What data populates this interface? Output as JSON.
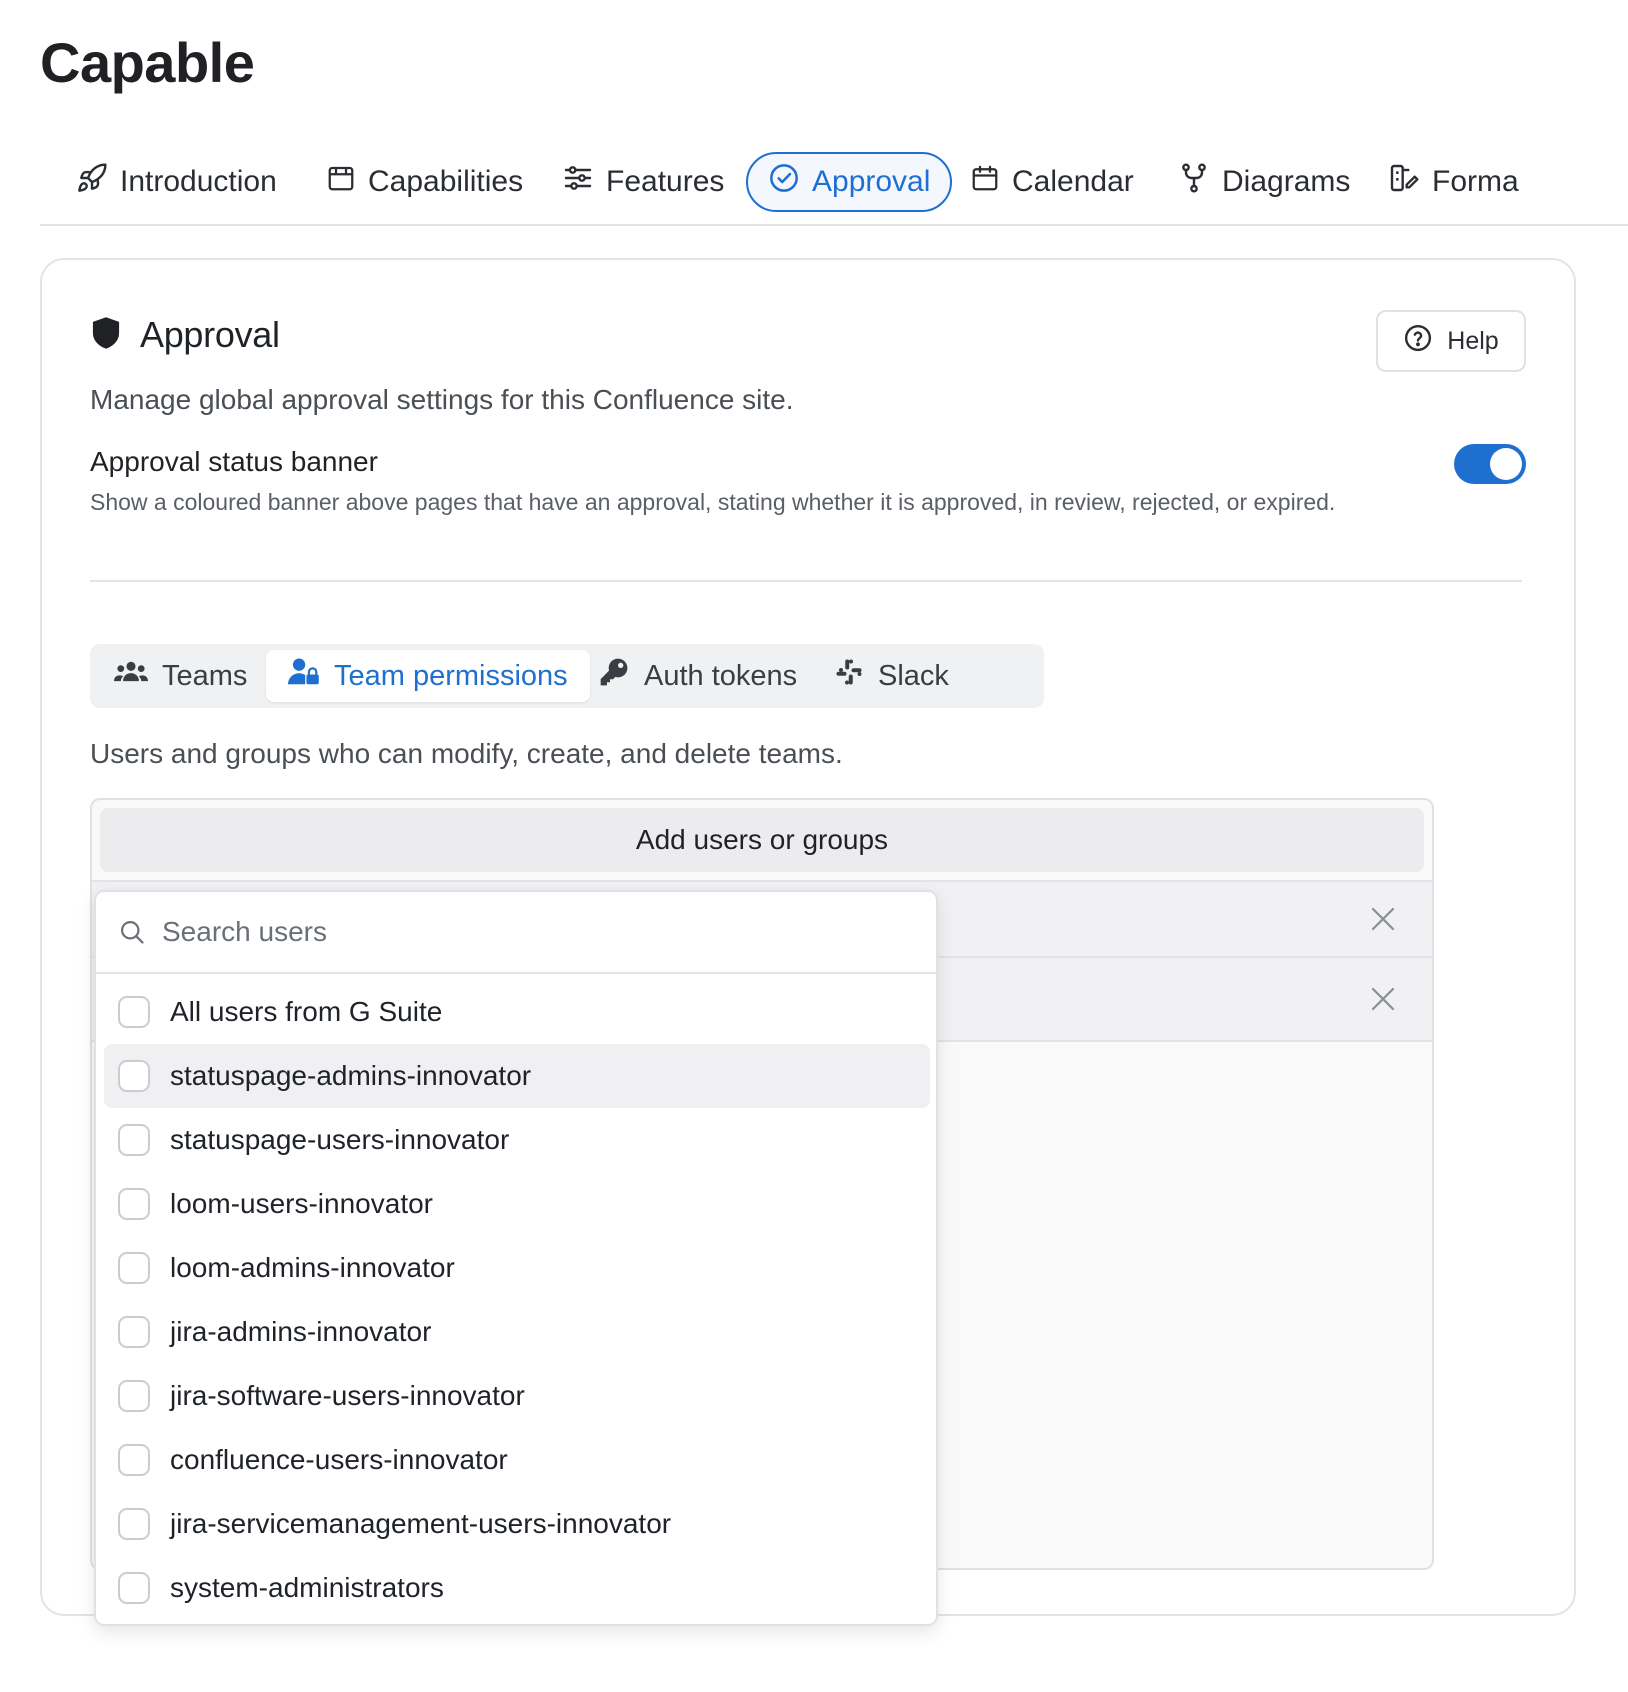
{
  "app": {
    "title": "Capable"
  },
  "nav": {
    "tabs": [
      {
        "label": "Introduction",
        "icon": "rocket-icon"
      },
      {
        "label": "Capabilities",
        "icon": "box-icon"
      },
      {
        "label": "Features",
        "icon": "sliders-icon"
      },
      {
        "label": "Approval",
        "icon": "check-circle-icon",
        "active": true
      },
      {
        "label": "Calendar",
        "icon": "calendar-icon"
      },
      {
        "label": "Diagrams",
        "icon": "git-fork-icon"
      },
      {
        "label": "Forma",
        "icon": "format-icon"
      }
    ]
  },
  "card": {
    "title": "Approval",
    "title_icon": "shield-icon",
    "help_label": "Help",
    "subtitle": "Manage global approval settings for this Confluence site.",
    "banner_setting": {
      "label": "Approval status banner",
      "description": "Show a coloured banner above pages that have an approval, stating whether it is approved, in review, rejected, or expired.",
      "enabled": true
    }
  },
  "subtabs": {
    "items": [
      {
        "label": "Teams",
        "icon": "users-icon"
      },
      {
        "label": "Team permissions",
        "icon": "user-lock-icon",
        "active": true
      },
      {
        "label": "Auth tokens",
        "icon": "key-icon"
      },
      {
        "label": "Slack",
        "icon": "slack-icon"
      }
    ]
  },
  "permissions": {
    "description": "Users and groups who can modify, create, and delete teams.",
    "add_label": "Add users or groups"
  },
  "dropdown": {
    "search_placeholder": "Search users",
    "options": [
      "All users from G Suite",
      "statuspage-admins-innovator",
      "statuspage-users-innovator",
      "loom-users-innovator",
      "loom-admins-innovator",
      "jira-admins-innovator",
      "jira-software-users-innovator",
      "confluence-users-innovator",
      "jira-servicemanagement-users-innovator",
      "system-administrators"
    ],
    "hovered_index": 1
  },
  "colors": {
    "accent": "#1f6fd0",
    "border": "#e3e4e6",
    "text": "#1f2328"
  }
}
